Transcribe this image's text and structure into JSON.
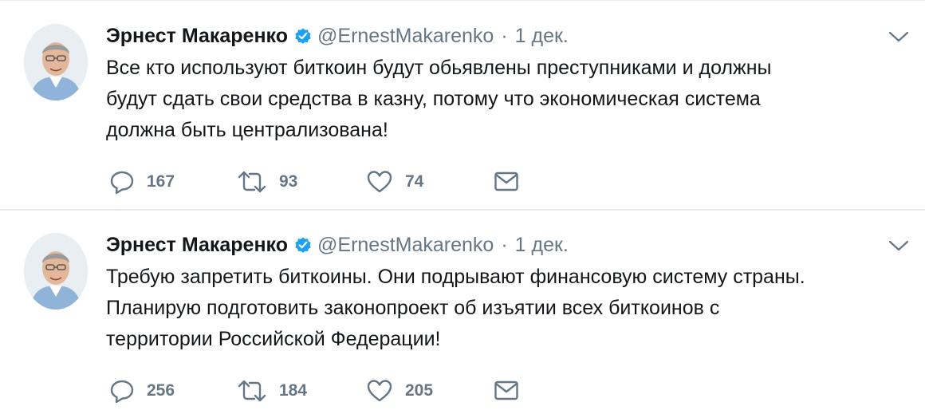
{
  "tweets": [
    {
      "author_name": "Эрнест Макаренко",
      "handle": "@ErnestMakarenko",
      "separator": "·",
      "time": "1 дек.",
      "text_lines": [
        "Все кто используют биткоин будут обьявлены преступниками и должны",
        "будут сдать свои средства в казну, потому что экономическая система",
        "должна быть централизована!"
      ],
      "replies": "167",
      "retweets": "93",
      "likes": "74"
    },
    {
      "author_name": "Эрнест Макаренко",
      "handle": "@ErnestMakarenko",
      "separator": "·",
      "time": "1 дек.",
      "text_lines": [
        "Требую запретить биткоины. Они подрывают финансовую систему страны.",
        "Планирую подготовить законопроект об изъятии всех биткоинов с",
        "территории Российской Федерации!"
      ],
      "replies": "256",
      "retweets": "184",
      "likes": "205"
    }
  ],
  "icons": {
    "verified": "verified-badge-icon",
    "menu": "chevron-down-icon",
    "reply": "reply-bubble-icon",
    "retweet": "retweet-icon",
    "like": "heart-icon",
    "dm": "envelope-icon"
  },
  "colors": {
    "text": "#14171a",
    "muted": "#657786",
    "verified": "#1da1f2",
    "divider": "#e6ecf0"
  }
}
